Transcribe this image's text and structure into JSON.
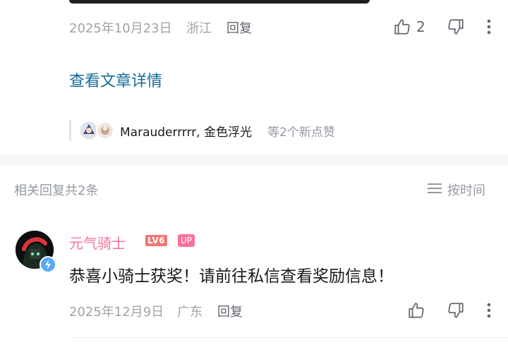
{
  "comment1": {
    "date": "2025年10月23日",
    "location": "浙江",
    "reply_label": "回复",
    "like_count": "2",
    "like_icon": "thumbs-up-icon",
    "dislike_icon": "thumbs-down-icon",
    "more_icon": "more-vertical-icon"
  },
  "article_link": "查看文章详情",
  "likes_row": {
    "names": "Marauderrrrr, 金色浮光",
    "suffix": "等2个新点赞"
  },
  "related": {
    "title": "相关回复共2条",
    "sort_label": "按时间",
    "sort_icon": "menu-lines-icon"
  },
  "comment2": {
    "username": "元气骑士",
    "level_badge": "LV6",
    "up_badge": "UP",
    "content": "恭喜小骑士获奖！请前往私信查看奖励信息！",
    "date": "2025年12月9日",
    "location": "广东",
    "reply_label": "回复"
  },
  "colors": {
    "accent_link": "#156b99",
    "username_pink": "#fb7299",
    "meta_gray": "#a0a3a8"
  }
}
